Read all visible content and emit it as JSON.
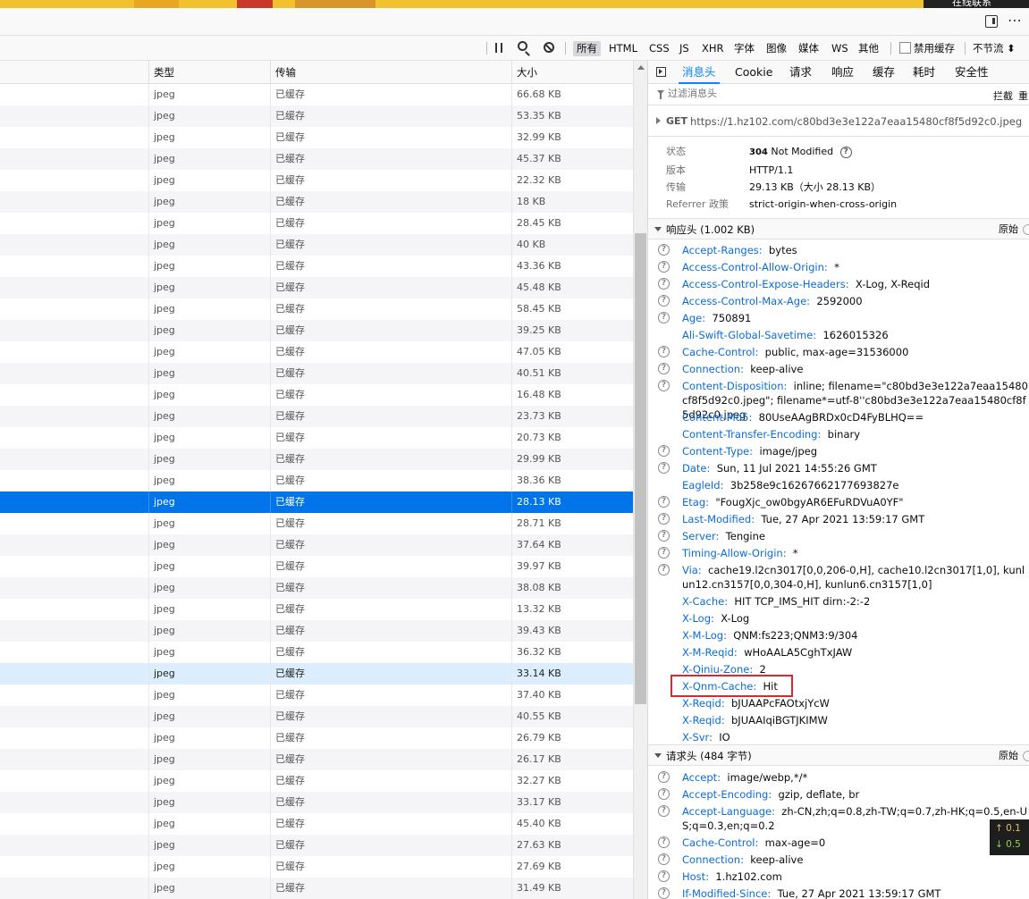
{
  "banner": {
    "text": "在线联系"
  },
  "toolbar": {
    "filters": [
      "所有",
      "HTML",
      "CSS",
      "JS",
      "XHR",
      "字体",
      "图像",
      "媒体",
      "WS",
      "其他"
    ],
    "active_filter": "所有",
    "disable_cache_label": "禁用缓存",
    "throttle_label": "不节流 ⬍"
  },
  "list": {
    "columns": [
      "类型",
      "传输",
      "大小"
    ],
    "rows": [
      [
        "jpeg",
        "已缓存",
        "66.68 KB"
      ],
      [
        "jpeg",
        "已缓存",
        "53.35 KB"
      ],
      [
        "jpeg",
        "已缓存",
        "32.99 KB"
      ],
      [
        "jpeg",
        "已缓存",
        "45.37 KB"
      ],
      [
        "jpeg",
        "已缓存",
        "22.32 KB"
      ],
      [
        "jpeg",
        "已缓存",
        "18 KB"
      ],
      [
        "jpeg",
        "已缓存",
        "28.45 KB"
      ],
      [
        "jpeg",
        "已缓存",
        "40 KB"
      ],
      [
        "jpeg",
        "已缓存",
        "43.36 KB"
      ],
      [
        "jpeg",
        "已缓存",
        "45.48 KB"
      ],
      [
        "jpeg",
        "已缓存",
        "58.45 KB"
      ],
      [
        "jpeg",
        "已缓存",
        "39.25 KB"
      ],
      [
        "jpeg",
        "已缓存",
        "47.05 KB"
      ],
      [
        "jpeg",
        "已缓存",
        "40.51 KB"
      ],
      [
        "jpeg",
        "已缓存",
        "16.48 KB"
      ],
      [
        "jpeg",
        "已缓存",
        "23.73 KB"
      ],
      [
        "jpeg",
        "已缓存",
        "20.73 KB"
      ],
      [
        "jpeg",
        "已缓存",
        "29.99 KB"
      ],
      [
        "jpeg",
        "已缓存",
        "38.36 KB"
      ],
      [
        "jpeg",
        "已缓存",
        "28.13 KB"
      ],
      [
        "jpeg",
        "已缓存",
        "28.71 KB"
      ],
      [
        "jpeg",
        "已缓存",
        "37.64 KB"
      ],
      [
        "jpeg",
        "已缓存",
        "39.97 KB"
      ],
      [
        "jpeg",
        "已缓存",
        "38.08 KB"
      ],
      [
        "jpeg",
        "已缓存",
        "13.32 KB"
      ],
      [
        "jpeg",
        "已缓存",
        "39.43 KB"
      ],
      [
        "jpeg",
        "已缓存",
        "36.32 KB"
      ],
      [
        "jpeg",
        "已缓存",
        "33.14 KB"
      ],
      [
        "jpeg",
        "已缓存",
        "37.40 KB"
      ],
      [
        "jpeg",
        "已缓存",
        "40.55 KB"
      ],
      [
        "jpeg",
        "已缓存",
        "26.79 KB"
      ],
      [
        "jpeg",
        "已缓存",
        "26.17 KB"
      ],
      [
        "jpeg",
        "已缓存",
        "32.27 KB"
      ],
      [
        "jpeg",
        "已缓存",
        "33.17 KB"
      ],
      [
        "jpeg",
        "已缓存",
        "45.40 KB"
      ],
      [
        "jpeg",
        "已缓存",
        "27.63 KB"
      ],
      [
        "jpeg",
        "已缓存",
        "27.69 KB"
      ],
      [
        "jpeg",
        "已缓存",
        "31.49 KB"
      ]
    ],
    "selected_index": 19,
    "hover_index": 27
  },
  "panel": {
    "tabs": [
      "消息头",
      "Cookie",
      "请求",
      "响应",
      "缓存",
      "耗时",
      "安全性"
    ],
    "active_tab": "消息头",
    "filter_placeholder": "过滤消息头",
    "block_label": "拦截",
    "resend_label": "重",
    "method": "GET",
    "url": "https://1.hz102.com/c80bd3e3e122a7eaa15480cf8f5d92c0.jpeg",
    "summary": [
      {
        "k": "状态",
        "code": "304",
        "v": "Not Modified"
      },
      {
        "k": "版本",
        "v": "HTTP/1.1"
      },
      {
        "k": "传输",
        "v": "29.13 KB（大小 28.13 KB）"
      },
      {
        "k": "Referrer 政策",
        "v": "strict-origin-when-cross-origin"
      }
    ],
    "response_title": "响应头 (1.002 KB)",
    "raw_label": "原始",
    "response_headers": [
      {
        "n": "Accept-Ranges",
        "v": "bytes",
        "q": true
      },
      {
        "n": "Access-Control-Allow-Origin",
        "v": "*",
        "q": true
      },
      {
        "n": "Access-Control-Expose-Headers",
        "v": "X-Log, X-Reqid",
        "q": true
      },
      {
        "n": "Access-Control-Max-Age",
        "v": "2592000",
        "q": true
      },
      {
        "n": "Age",
        "v": "750891",
        "q": true
      },
      {
        "n": "Ali-Swift-Global-Savetime",
        "v": "1626015326",
        "q": false
      },
      {
        "n": "Cache-Control",
        "v": "public, max-age=31536000",
        "q": true
      },
      {
        "n": "Connection",
        "v": "keep-alive",
        "q": true
      },
      {
        "n": "Content-Disposition",
        "v": "inline; filename=\"c80bd3e3e122a7eaa15480cf8f5d92c0.jpeg\"; filename*=utf-8''c80bd3e3e122a7eaa15480cf8f5d92c0.jpeg",
        "q": true,
        "lines": 2
      },
      {
        "n": "Content-Md5",
        "v": "80UseAAgBRDx0cD4FyBLHQ==",
        "q": false
      },
      {
        "n": "Content-Transfer-Encoding",
        "v": "binary",
        "q": false
      },
      {
        "n": "Content-Type",
        "v": "image/jpeg",
        "q": true
      },
      {
        "n": "Date",
        "v": "Sun, 11 Jul 2021 14:55:26 GMT",
        "q": true
      },
      {
        "n": "EagleId",
        "v": "3b258e9c16267662177693827e",
        "q": false
      },
      {
        "n": "Etag",
        "v": "\"FougXjc_ow0bgyAR6EFuRDVuA0YF\"",
        "q": true
      },
      {
        "n": "Last-Modified",
        "v": "Tue, 27 Apr 2021 13:59:17 GMT",
        "q": true
      },
      {
        "n": "Server",
        "v": "Tengine",
        "q": true
      },
      {
        "n": "Timing-Allow-Origin",
        "v": "*",
        "q": true
      },
      {
        "n": "Via",
        "v": "cache19.l2cn3017[0,0,206-0,H], cache10.l2cn3017[1,0], kunlun12.cn3157[0,0,304-0,H], kunlun6.cn3157[1,0]",
        "q": true,
        "lines": 2
      },
      {
        "n": "X-Cache",
        "v": "HIT TCP_IMS_HIT dirn:-2:-2",
        "q": false
      },
      {
        "n": "X-Log",
        "v": "X-Log",
        "q": false
      },
      {
        "n": "X-M-Log",
        "v": "QNM:fs223;QNM3:9/304",
        "q": false
      },
      {
        "n": "X-M-Reqid",
        "v": "wHoAALA5CghTxJAW",
        "q": false
      },
      {
        "n": "X-Qiniu-Zone",
        "v": "2",
        "q": false
      },
      {
        "n": "X-Qnm-Cache",
        "v": "Hit",
        "q": false
      },
      {
        "n": "X-Reqid",
        "v": "bJUAAPcFAOtxjYcW",
        "q": false
      },
      {
        "n": "X-Reqid",
        "v": "bJUAAIqiBGTJKIMW",
        "q": false
      },
      {
        "n": "X-Svr",
        "v": "IO",
        "q": false
      }
    ],
    "request_title": "请求头 (484 字节)",
    "request_headers": [
      {
        "n": "Accept",
        "v": "image/webp,*/*",
        "q": true
      },
      {
        "n": "Accept-Encoding",
        "v": "gzip, deflate, br",
        "q": true
      },
      {
        "n": "Accept-Language",
        "v": "zh-CN,zh;q=0.8,zh-TW;q=0.7,zh-HK;q=0.5,en-US;q=0.3,en;q=0.2",
        "q": true,
        "lines": 2
      },
      {
        "n": "Cache-Control",
        "v": "max-age=0",
        "q": true
      },
      {
        "n": "Connection",
        "v": "keep-alive",
        "q": true
      },
      {
        "n": "Host",
        "v": "1.hz102.com",
        "q": true
      },
      {
        "n": "If-Modified-Since",
        "v": "Tue, 27 Apr 2021 13:59:17 GMT",
        "q": true
      }
    ]
  },
  "netmon": {
    "up": "↑ 0.1",
    "down": "↓ 0.5"
  }
}
